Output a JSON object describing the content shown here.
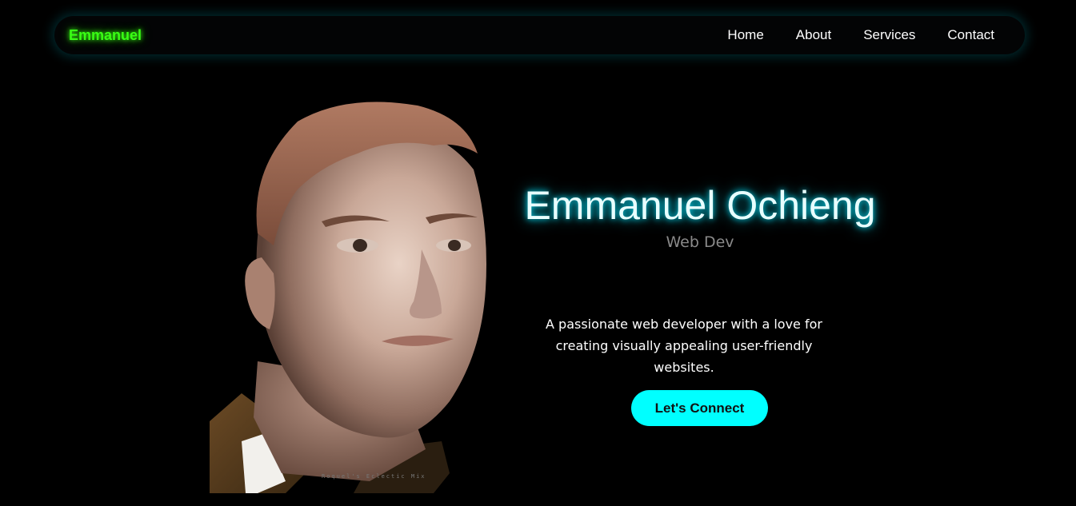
{
  "nav": {
    "brand": "Emmanuel",
    "links": [
      {
        "label": "Home"
      },
      {
        "label": "About"
      },
      {
        "label": "Services"
      },
      {
        "label": "Contact"
      }
    ]
  },
  "hero": {
    "name": "Emmanuel Ochieng",
    "role": "Web Dev",
    "description": "A passionate web developer with a love for creating visually appealing user-friendly websites.",
    "cta_label": "Let's Connect",
    "portrait_icon": "mannequin-head-portrait"
  },
  "colors": {
    "background": "#000000",
    "brand_green": "#39ff14",
    "accent_cyan": "#00ffff",
    "role_gray": "#8a8a8a"
  }
}
